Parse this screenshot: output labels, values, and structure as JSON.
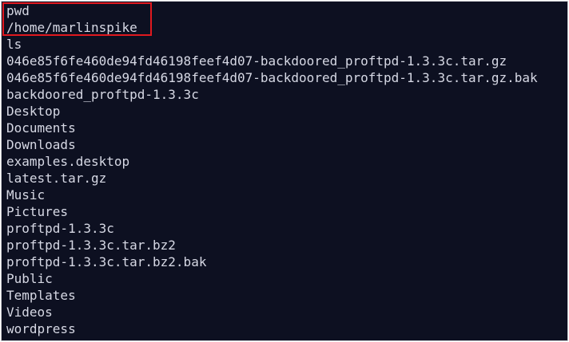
{
  "terminal": {
    "lines": [
      "pwd",
      "/home/marlinspike",
      "ls",
      "046e85f6fe460de94fd46198feef4d07-backdoored_proftpd-1.3.3c.tar.gz",
      "046e85f6fe460de94fd46198feef4d07-backdoored_proftpd-1.3.3c.tar.gz.bak",
      "backdoored_proftpd-1.3.3c",
      "Desktop",
      "Documents",
      "Downloads",
      "examples.desktop",
      "latest.tar.gz",
      "Music",
      "Pictures",
      "proftpd-1.3.3c",
      "proftpd-1.3.3c.tar.bz2",
      "proftpd-1.3.3c.tar.bz2.bak",
      "Public",
      "Templates",
      "Videos",
      "wordpress"
    ]
  },
  "colors": {
    "background": "#0d1021",
    "text": "#d6d8e4",
    "highlight": "#e0191f"
  }
}
